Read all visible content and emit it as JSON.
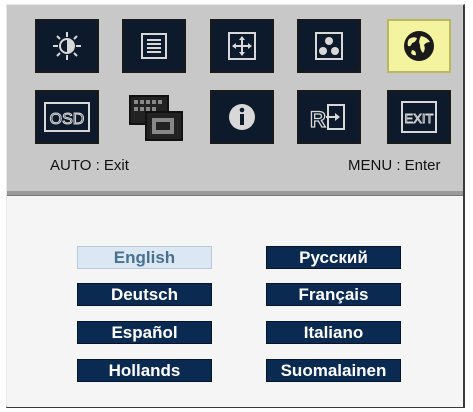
{
  "menu_icons": [
    {
      "name": "brightness-icon",
      "selected": false
    },
    {
      "name": "image-settings-icon",
      "selected": false
    },
    {
      "name": "position-icon",
      "selected": false
    },
    {
      "name": "color-icon",
      "selected": false
    },
    {
      "name": "language-globe-icon",
      "selected": true
    },
    {
      "name": "osd-icon",
      "selected": false
    },
    {
      "name": "input-source-icon",
      "selected": false
    },
    {
      "name": "information-icon",
      "selected": false
    },
    {
      "name": "reset-icon",
      "selected": false
    },
    {
      "name": "exit-icon",
      "selected": false
    }
  ],
  "osd_label": "OSD",
  "exit_label": "EXIT",
  "hints": {
    "auto": "AUTO : Exit",
    "menu": "MENU : Enter"
  },
  "languages": {
    "left": [
      "English",
      "Deutsch",
      "Español",
      "Hollands"
    ],
    "right": [
      "Русский",
      "Français",
      "Italiano",
      "Suomalainen"
    ],
    "selected": "English"
  },
  "colors": {
    "button_bg": "#0a2a52",
    "selected_button_bg": "#dbe8f4",
    "selected_icon_bg": "#f4f4a0",
    "panel_bg": "#c8c8c8"
  }
}
